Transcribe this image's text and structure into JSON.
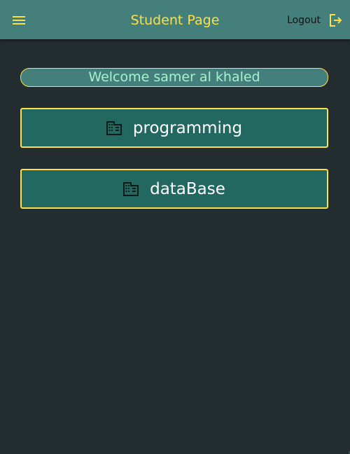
{
  "appbar": {
    "title": "Student Page",
    "logout_label": "Logout"
  },
  "welcome": {
    "text": "Welcome samer al khaled"
  },
  "courses": [
    {
      "label": "programming",
      "icon": "building-icon"
    },
    {
      "label": "dataBase",
      "icon": "building-icon"
    }
  ],
  "colors": {
    "background": "#232d30",
    "appbar": "#447f7b",
    "accent": "#fde047",
    "card": "#236860",
    "welcome_text": "#a7f3d0"
  }
}
